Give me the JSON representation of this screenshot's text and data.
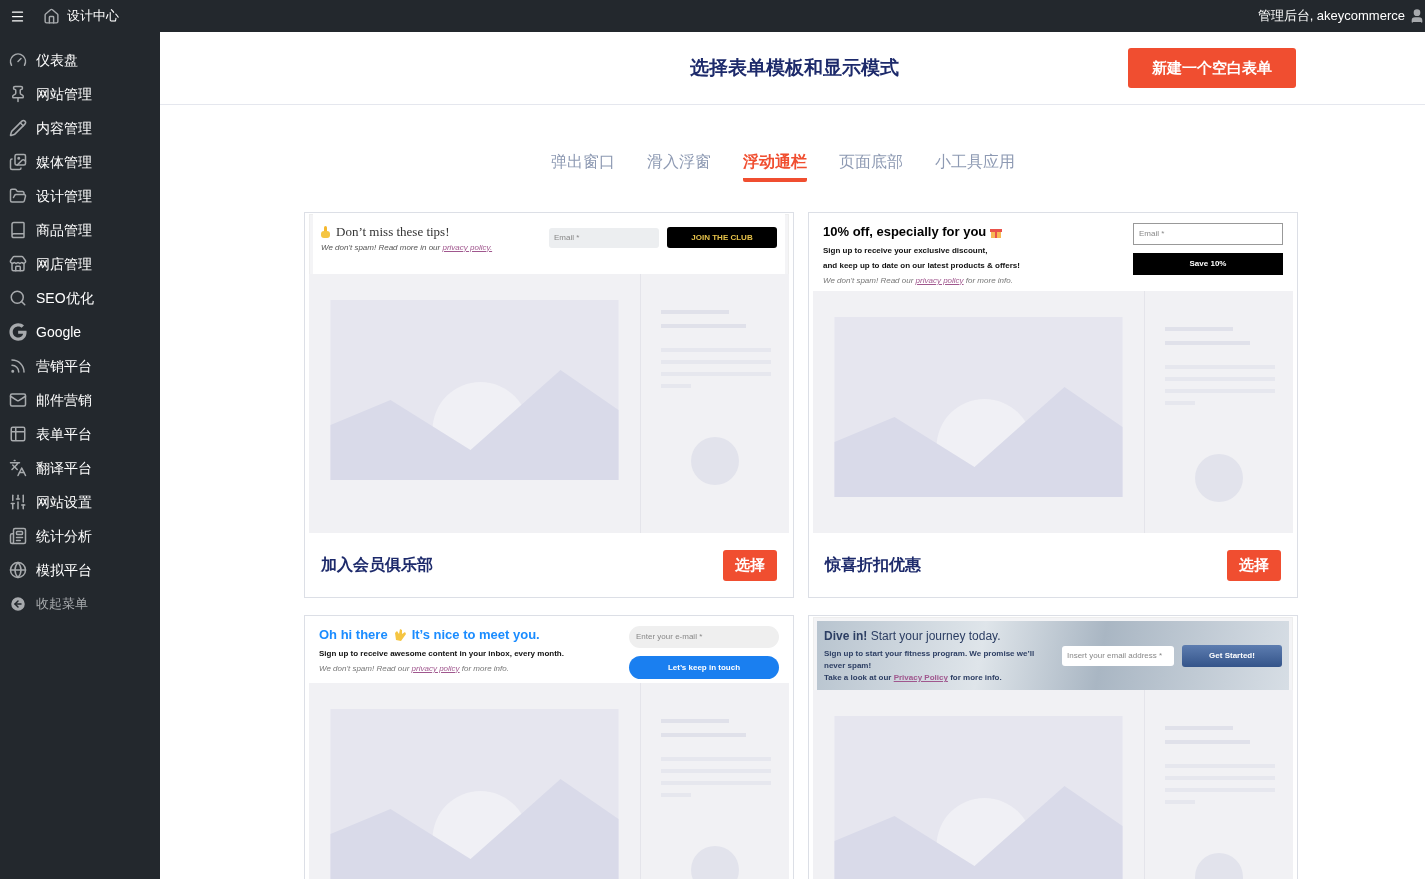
{
  "topbar": {
    "brand": "设计中心",
    "user": "管理后台, akeycommerce"
  },
  "sidebar": {
    "items": [
      {
        "label": "仪表盘"
      },
      {
        "label": "网站管理"
      },
      {
        "label": "内容管理"
      },
      {
        "label": "媒体管理"
      },
      {
        "label": "设计管理"
      },
      {
        "label": "商品管理"
      },
      {
        "label": "网店管理"
      },
      {
        "label": "SEO优化"
      },
      {
        "label": "Google"
      },
      {
        "label": "营销平台"
      },
      {
        "label": "邮件营销"
      },
      {
        "label": "表单平台"
      },
      {
        "label": "翻译平台"
      },
      {
        "label": "网站设置"
      },
      {
        "label": "统计分析"
      },
      {
        "label": "模拟平台"
      }
    ],
    "collapse_label": "收起菜单"
  },
  "header": {
    "title": "选择表单模板和显示模式",
    "new_button": "新建一个空白表单"
  },
  "tabs": [
    {
      "label": "弹出窗口",
      "selected": false
    },
    {
      "label": "滑入浮窗",
      "selected": false
    },
    {
      "label": "浮动通栏",
      "selected": true
    },
    {
      "label": "页面底部",
      "selected": false
    },
    {
      "label": "小工具应用",
      "selected": false
    }
  ],
  "cards": [
    {
      "title": "加入会员俱乐部",
      "button": "选择",
      "preview": {
        "kind": "serif",
        "heading": "Don’t miss these tips!",
        "note_before": "We don't spam! Read more in our",
        "link": "privacy policy.",
        "placeholder": "Email *",
        "button": "JOIN THE CLUB"
      }
    },
    {
      "title": "惊喜折扣优惠",
      "button": "选择",
      "preview": {
        "kind": "bold",
        "heading": "10% off, especially for you",
        "body": [
          "Sign up to receive your exclusive discount,",
          "and keep up to date on our latest products & offers!"
        ],
        "note_before": "We don't spam! Read our",
        "link": "privacy policy",
        "note_after": "for more info.",
        "placeholder": "Email *",
        "button": "Save 10%"
      }
    },
    {
      "preview": {
        "kind": "blue",
        "heading": "Oh hi there",
        "heading_after": "It’s nice to meet you.",
        "body": [
          "Sign up to receive awesome content in your inbox, every month."
        ],
        "note_before": "We don't spam! Read our",
        "link": "privacy policy",
        "note_after": "for more info.",
        "placeholder": "Enter your e-mail *",
        "button": "Let’s keep in touch"
      }
    },
    {
      "preview": {
        "kind": "banner",
        "heading": "**Dive in!** Start your journey today.",
        "body": [
          "Sign up to start your fitness program. We promise we’ll never spam!"
        ],
        "note_before": "Take a look at our",
        "link": "Privacy Policy",
        "note_after": "for more info.",
        "placeholder": "Insert your email address *",
        "button": "Get Started!"
      }
    }
  ]
}
